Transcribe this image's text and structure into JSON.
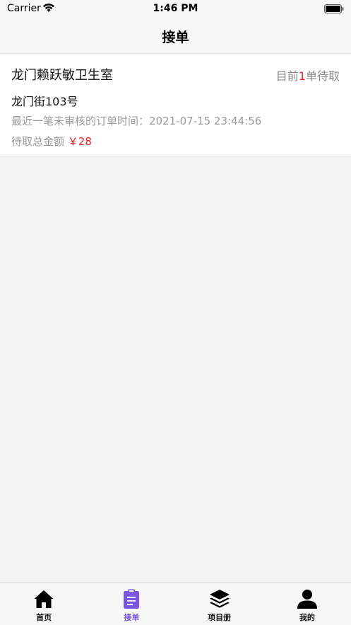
{
  "status_bar": {
    "carrier": "Carrier",
    "time": "1:46 PM"
  },
  "nav": {
    "title": "接单"
  },
  "card": {
    "clinic_name": "龙门赖跃敏卫生室",
    "pending_prefix": "目前",
    "pending_count": "1",
    "pending_suffix": "单待取",
    "address": "龙门街103号",
    "last_order_label": "最近一笔未审核的订单时间：",
    "last_order_time": "2021-07-15 23:44:56",
    "total_label": "待取总金额",
    "total_amount": "￥28"
  },
  "tabs": [
    {
      "label": "首页",
      "icon": "home-icon",
      "active": false
    },
    {
      "label": "接单",
      "icon": "clipboard-icon",
      "active": true
    },
    {
      "label": "项目册",
      "icon": "layers-icon",
      "active": false
    },
    {
      "label": "我的",
      "icon": "person-icon",
      "active": false
    }
  ],
  "colors": {
    "accent": "#7a55e0",
    "highlight": "#e02020"
  }
}
